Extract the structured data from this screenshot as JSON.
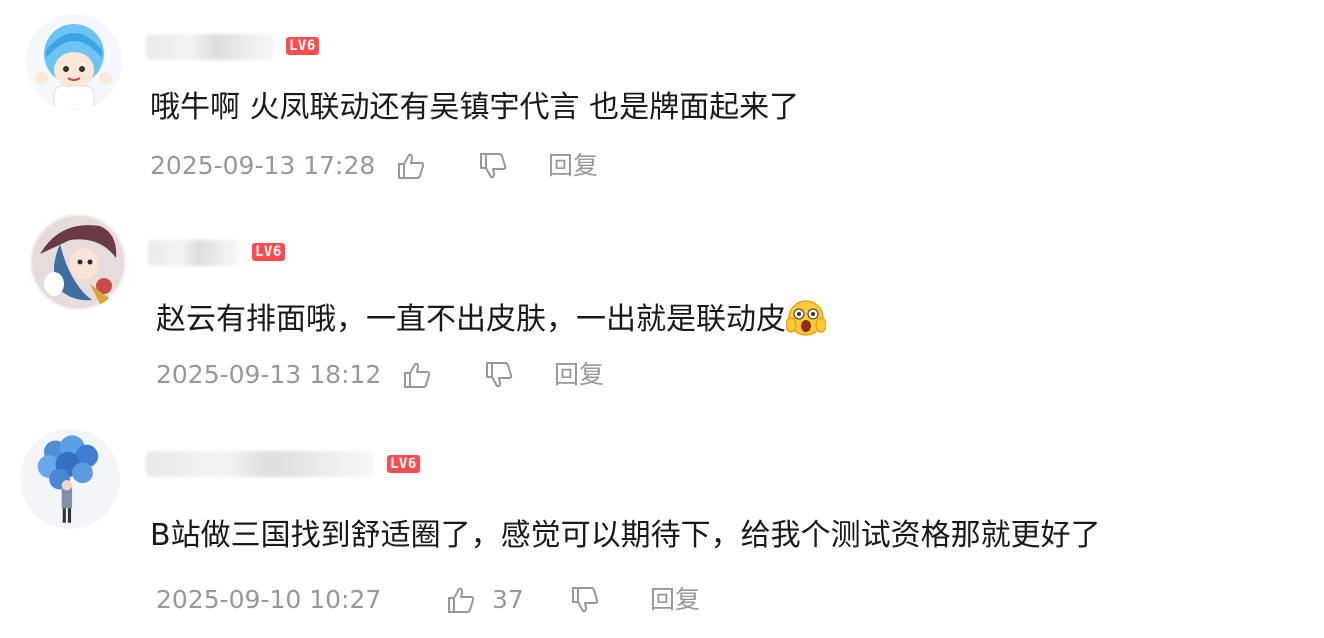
{
  "comments": [
    {
      "level": "LV6",
      "text": "哦牛啊 火凤联动还有吴镇宇代言 也是牌面起来了",
      "time": "2025-09-13 17:28",
      "likes": "",
      "reply": "回复"
    },
    {
      "level": "LV6",
      "text": "赵云有排面哦，一直不出皮肤，一出就是联动皮",
      "time": "2025-09-13 18:12",
      "likes": "",
      "reply": "回复"
    },
    {
      "level": "LV6",
      "text": "B站做三国找到舒适圈了，感觉可以期待下，给我个测试资格那就更好了",
      "time": "2025-09-10 10:27",
      "likes": "37",
      "reply": "回复"
    }
  ],
  "icons": {
    "like": "thumbs-up-icon",
    "dislike": "thumbs-down-icon",
    "emoji": "shocked-face-emoji"
  },
  "colors": {
    "level_badge": "#ff4d4f",
    "meta_text": "#9499a0",
    "comment_text": "#18191c"
  }
}
